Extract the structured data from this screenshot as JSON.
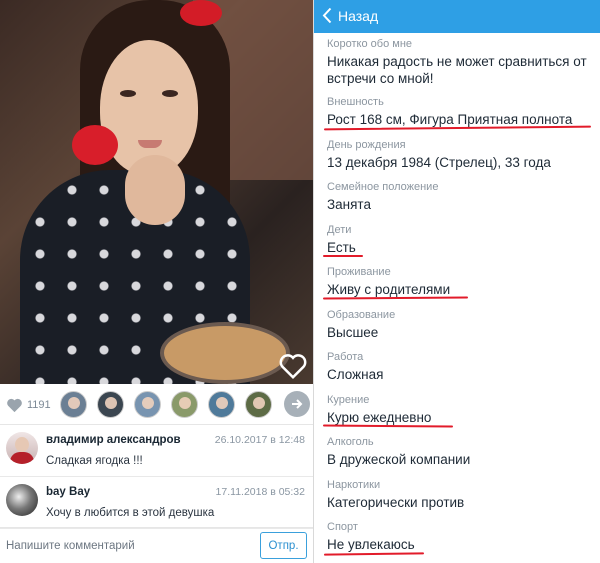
{
  "left": {
    "likes_count": "1191",
    "comments": [
      {
        "name": "владимир александров",
        "date": "26.10.2017 в 12:48",
        "text": "Сладкая ягодка !!!"
      },
      {
        "name": "bay Bay",
        "date": "17.11.2018 в 05:32",
        "text": "Хочу в любится в этой девушка"
      }
    ],
    "composer": {
      "placeholder": "Напишите комментарий",
      "send_label": "Отпр."
    }
  },
  "right": {
    "back_label": "Назад",
    "fields": [
      {
        "label": "Коротко обо мне",
        "value_line1": "Никакая радость не может сравниться от",
        "value_line2": "встречи со мной!"
      },
      {
        "label": "Внешность",
        "value": "Рост 168 см, Фигура Приятная полнота"
      },
      {
        "label": "День рождения",
        "value": "13 декабря 1984 (Стрелец), 33 года"
      },
      {
        "label": "Семейное положение",
        "value": "Занята"
      },
      {
        "label": "Дети",
        "value": "Есть"
      },
      {
        "label": "Проживание",
        "value": "Живу с родителями"
      },
      {
        "label": "Образование",
        "value": "Высшее"
      },
      {
        "label": "Работа",
        "value": "Сложная"
      },
      {
        "label": "Курение",
        "value": "Курю ежедневно"
      },
      {
        "label": "Алкоголь",
        "value": "В дружеской компании"
      },
      {
        "label": "Наркотики",
        "value": "Категорически против"
      },
      {
        "label": "Спорт",
        "value": "Не увлекаюсь"
      }
    ]
  },
  "colors": {
    "accent": "#2e9fe5",
    "underline": "#e21b2a"
  }
}
